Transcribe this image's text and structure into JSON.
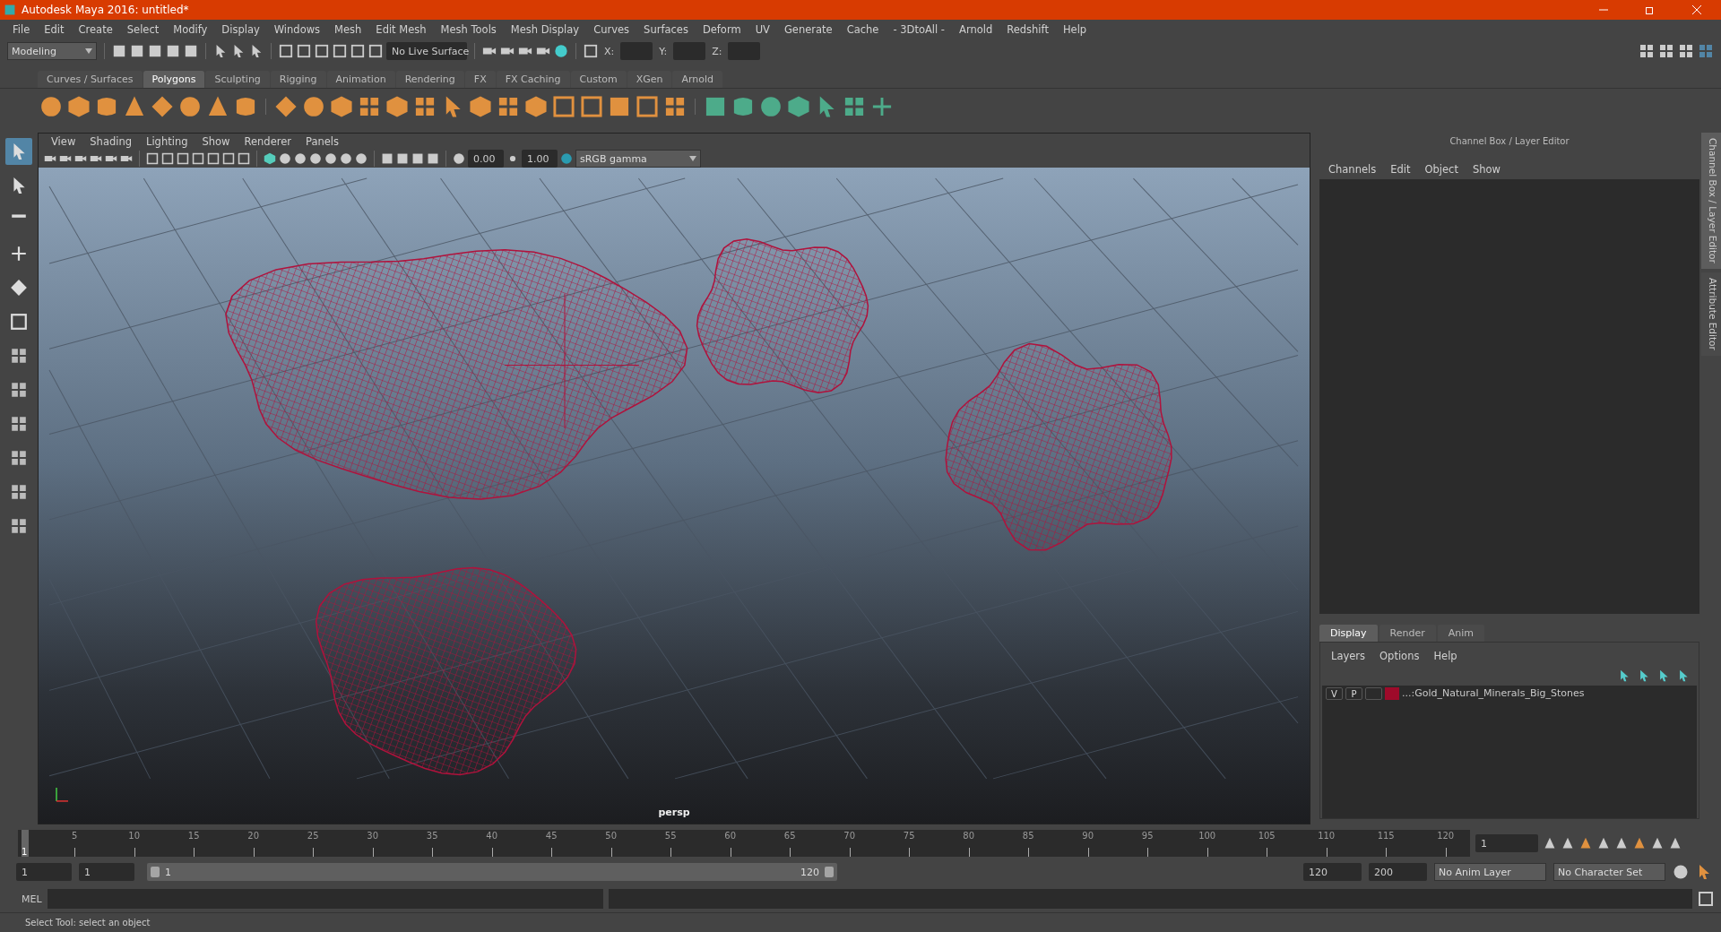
{
  "window": {
    "title": "Autodesk Maya 2016: untitled*"
  },
  "menu": [
    "File",
    "Edit",
    "Create",
    "Select",
    "Modify",
    "Display",
    "Windows",
    "Mesh",
    "Edit Mesh",
    "Mesh Tools",
    "Mesh Display",
    "Curves",
    "Surfaces",
    "Deform",
    "UV",
    "Generate",
    "Cache",
    "- 3DtoAll -",
    "Arnold",
    "Redshift",
    "Help"
  ],
  "status_line": {
    "workspace": "Modeling",
    "live_surface": "No Live Surface",
    "coords": [
      {
        "label": "X:"
      },
      {
        "label": "Y:"
      },
      {
        "label": "Z:"
      }
    ]
  },
  "shelf_tabs": [
    {
      "label": "Curves / Surfaces",
      "selected": false
    },
    {
      "label": "Polygons",
      "selected": true
    },
    {
      "label": "Sculpting",
      "selected": false
    },
    {
      "label": "Rigging",
      "selected": false
    },
    {
      "label": "Animation",
      "selected": false
    },
    {
      "label": "Rendering",
      "selected": false
    },
    {
      "label": "FX",
      "selected": false
    },
    {
      "label": "FX Caching",
      "selected": false
    },
    {
      "label": "Custom",
      "selected": false
    },
    {
      "label": "XGen",
      "selected": false
    },
    {
      "label": "Arnold",
      "selected": false
    }
  ],
  "viewport": {
    "menu": [
      "View",
      "Shading",
      "Lighting",
      "Show",
      "Renderer",
      "Panels"
    ],
    "exposure": "0.00",
    "gamma": "1.00",
    "color_space": "sRGB gamma",
    "camera": "persp"
  },
  "channel_box": {
    "title": "Channel Box / Layer Editor",
    "menu": [
      "Channels",
      "Edit",
      "Object",
      "Show"
    ]
  },
  "layer_editor": {
    "tabs": [
      {
        "label": "Display",
        "selected": true
      },
      {
        "label": "Render",
        "selected": false
      },
      {
        "label": "Anim",
        "selected": false
      }
    ],
    "menu": [
      "Layers",
      "Options",
      "Help"
    ],
    "layers": [
      {
        "visible": "V",
        "playback": "P",
        "color": "#9e0a2a",
        "name": "...:Gold_Natural_Minerals_Big_Stones"
      }
    ]
  },
  "side_tabs": [
    {
      "label": "Channel Box / Layer Editor",
      "selected": true
    },
    {
      "label": "Attribute Editor",
      "selected": false
    }
  ],
  "timeline": {
    "start_label": "1",
    "level": 0,
    "ticks": [
      "5",
      "10",
      "15",
      "20",
      "25",
      "30",
      "35",
      "40",
      "45",
      "50",
      "55",
      "60",
      "65",
      "70",
      "75",
      "80",
      "85",
      "90",
      "95",
      "100",
      "105",
      "110",
      "115",
      "120"
    ],
    "current_frame": "1"
  },
  "range": {
    "start": "1",
    "playback_start": "1",
    "slider_start": "1",
    "slider_end": "120",
    "level": 1,
    "playback_end": "120",
    "end": "200",
    "anim_layer": "No Anim Layer",
    "character_set": "No Character Set"
  },
  "command_line": {
    "label": "MEL"
  },
  "status_bar": {
    "text": "Select Tool: select an object"
  }
}
